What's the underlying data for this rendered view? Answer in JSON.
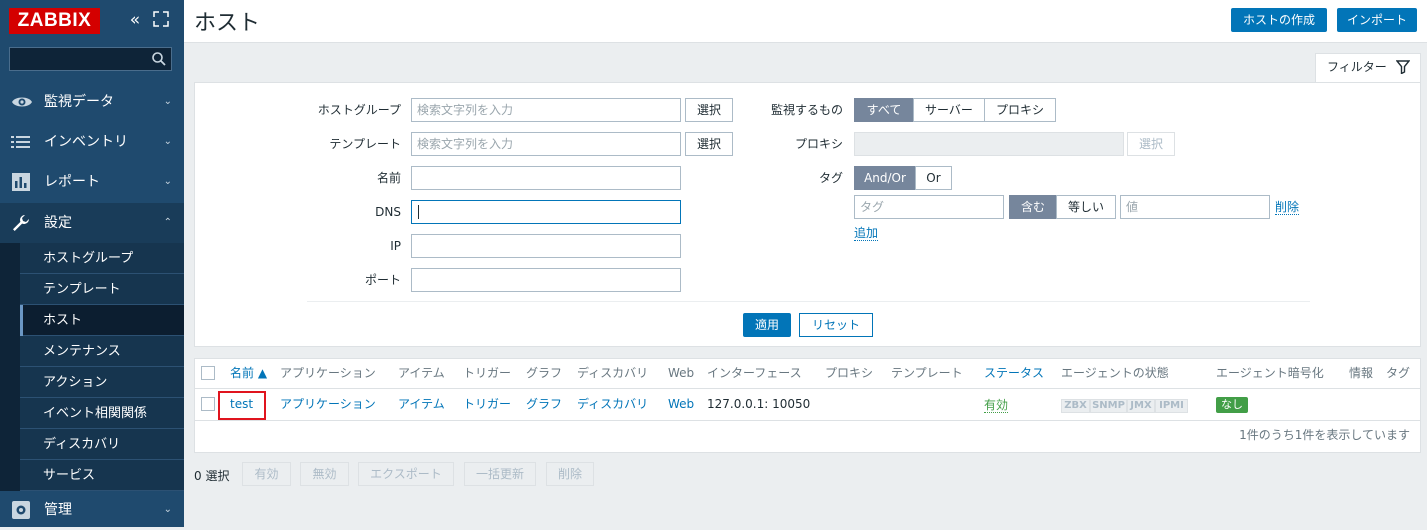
{
  "sidebar": {
    "logo": "ZABBIX",
    "collapse_icon": "double-chevron-left",
    "nav": {
      "monitoring": "監視データ",
      "inventory": "インベントリ",
      "reports": "レポート",
      "configuration": "設定",
      "administration": "管理"
    },
    "submenu": [
      "ホストグループ",
      "テンプレート",
      "ホスト",
      "メンテナンス",
      "アクション",
      "イベント相関関係",
      "ディスカバリ",
      "サービス"
    ],
    "active_submenu": "ホスト"
  },
  "header": {
    "title": "ホスト",
    "create_button": "ホストの作成",
    "import_button": "インポート"
  },
  "filter": {
    "tab_label": "フィルター",
    "host_group_label": "ホストグループ",
    "host_group_placeholder": "検索文字列を入力",
    "template_label": "テンプレート",
    "template_placeholder": "検索文字列を入力",
    "select_button": "選択",
    "name_label": "名前",
    "dns_label": "DNS",
    "ip_label": "IP",
    "port_label": "ポート",
    "monitored_by_label": "監視するもの",
    "monitored_by_options": [
      "すべて",
      "サーバー",
      "プロキシ"
    ],
    "monitored_by_selected": "すべて",
    "proxy_label": "プロキシ",
    "tags_label": "タグ",
    "tag_logic_options": [
      "And/Or",
      "Or"
    ],
    "tag_logic_selected": "And/Or",
    "tag_placeholder": "タグ",
    "tag_operator_options": [
      "含む",
      "等しい"
    ],
    "tag_operator_selected": "含む",
    "value_placeholder": "値",
    "remove_link": "削除",
    "add_link": "追加",
    "apply_button": "適用",
    "reset_button": "リセット"
  },
  "table": {
    "columns": [
      "名前 ▲",
      "アプリケーション",
      "アイテム",
      "トリガー",
      "グラフ",
      "ディスカバリ",
      "Web",
      "インターフェース",
      "プロキシ",
      "テンプレート",
      "ステータス",
      "エージェントの状態",
      "エージェント暗号化",
      "情報",
      "タグ"
    ],
    "rows": [
      {
        "name": "test",
        "applications": "アプリケーション",
        "items": "アイテム",
        "triggers": "トリガー",
        "graphs": "グラフ",
        "discovery": "ディスカバリ",
        "web": "Web",
        "interface": "127.0.0.1: 10050",
        "status": "有効",
        "agent_badges": [
          "ZBX",
          "SNMP",
          "JMX",
          "IPMI"
        ],
        "encryption": "なし"
      }
    ],
    "paging_text": "1件のうち1件を表示しています"
  },
  "footer": {
    "selected_count": "0 選択",
    "buttons": [
      "有効",
      "無効",
      "エクスポート",
      "一括更新",
      "削除"
    ]
  },
  "colors": {
    "sidebar_bg": "#1f4a6e",
    "accent": "#0275b8",
    "logo_red": "#d40000",
    "status_green": "#429e47",
    "highlight_red": "#e0141e"
  }
}
